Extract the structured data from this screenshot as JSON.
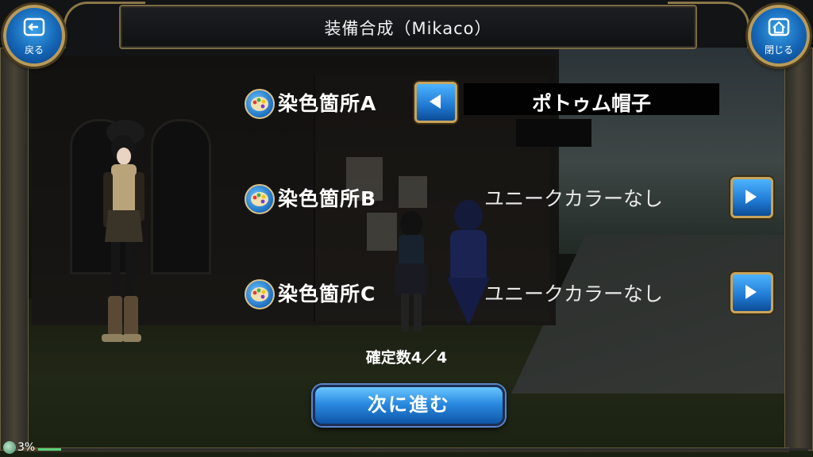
{
  "header": {
    "title": "装備合成（Mikaco）",
    "back_label": "戻る",
    "close_label": "閉じる"
  },
  "dye_slots": [
    {
      "label": "染色箇所A",
      "value": "ポトゥム帽子",
      "selected": true,
      "arrow": "left"
    },
    {
      "label": "染色箇所B",
      "value": "ユニークカラーなし",
      "selected": false,
      "arrow": "right"
    },
    {
      "label": "染色箇所C",
      "value": "ユニークカラーなし",
      "selected": false,
      "arrow": "right"
    }
  ],
  "confirm_count": "確定数4／4",
  "next_button": "次に進む",
  "status": {
    "percent_label": "3%",
    "progress": 0.03
  },
  "icons": {
    "back": "back-arrow-icon",
    "close": "home-icon",
    "palette": "palette-icon",
    "left": "left-arrow-icon",
    "right": "right-arrow-icon"
  },
  "colors": {
    "accent_blue": "#1f78d1",
    "gold_frame": "#b89a5a",
    "text": "#ffffff"
  }
}
